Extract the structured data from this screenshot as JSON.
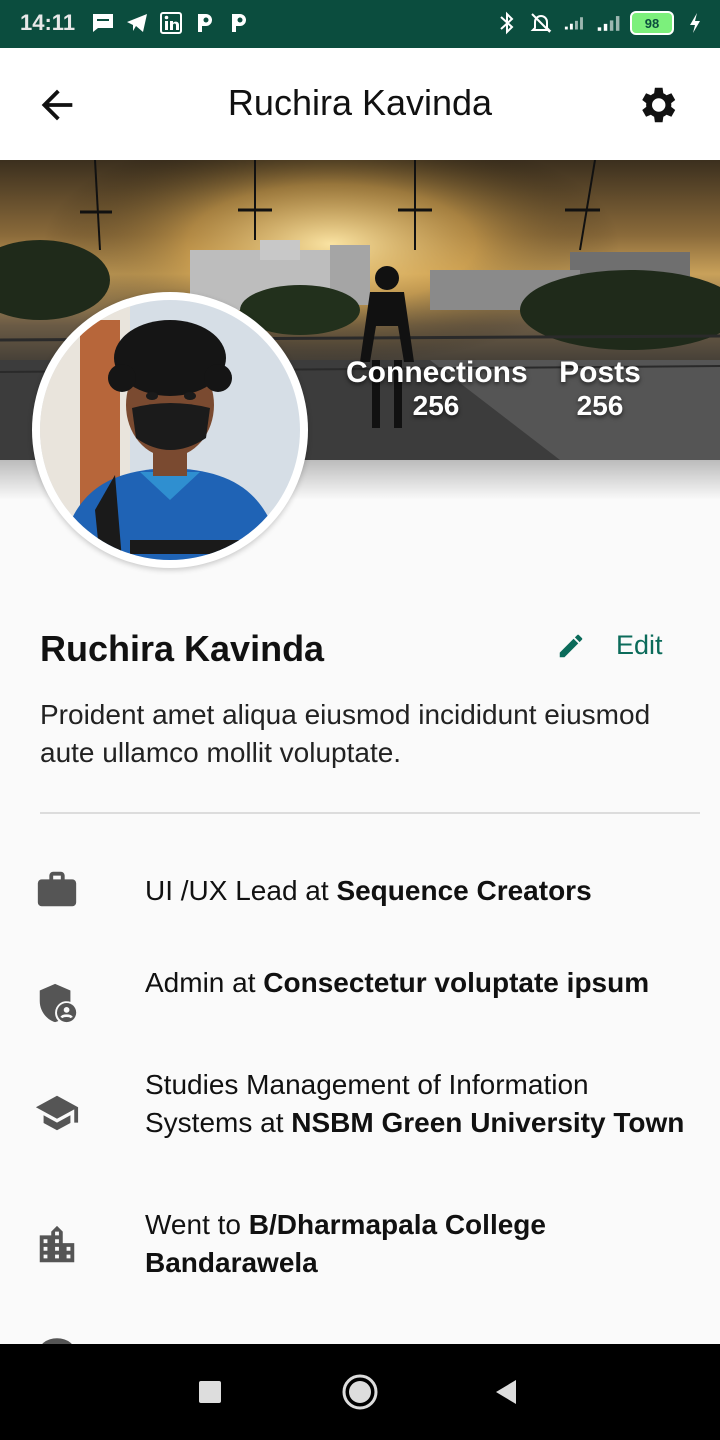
{
  "status_bar": {
    "time": "14:11",
    "battery": "98"
  },
  "app_bar": {
    "title": "Ruchira Kavinda"
  },
  "stats": {
    "connections_label": "Connections",
    "connections_value": "256",
    "posts_label": "Posts",
    "posts_value": "256"
  },
  "profile": {
    "name": "Ruchira Kavinda",
    "edit_label": "Edit",
    "bio": "Proident amet aliqua eiusmod incididunt eiusmod aute ullamco mollit voluptate."
  },
  "info": [
    {
      "icon": "briefcase-icon",
      "prefix": "UI /UX Lead at ",
      "bold": "Sequence Creators"
    },
    {
      "icon": "admin-shield-icon",
      "prefix": "Admin at ",
      "bold": "Consectetur voluptate ipsum"
    },
    {
      "icon": "graduation-cap-icon",
      "prefix": "Studies Management of Information Systems at ",
      "bold": "NSBM Green University Town"
    },
    {
      "icon": "building-icon",
      "prefix": "Went to ",
      "bold": "B/Dharmapala College Bandarawela"
    }
  ],
  "colors": {
    "status_bar": "#0b4d3e",
    "accent": "#0b6b5a"
  }
}
